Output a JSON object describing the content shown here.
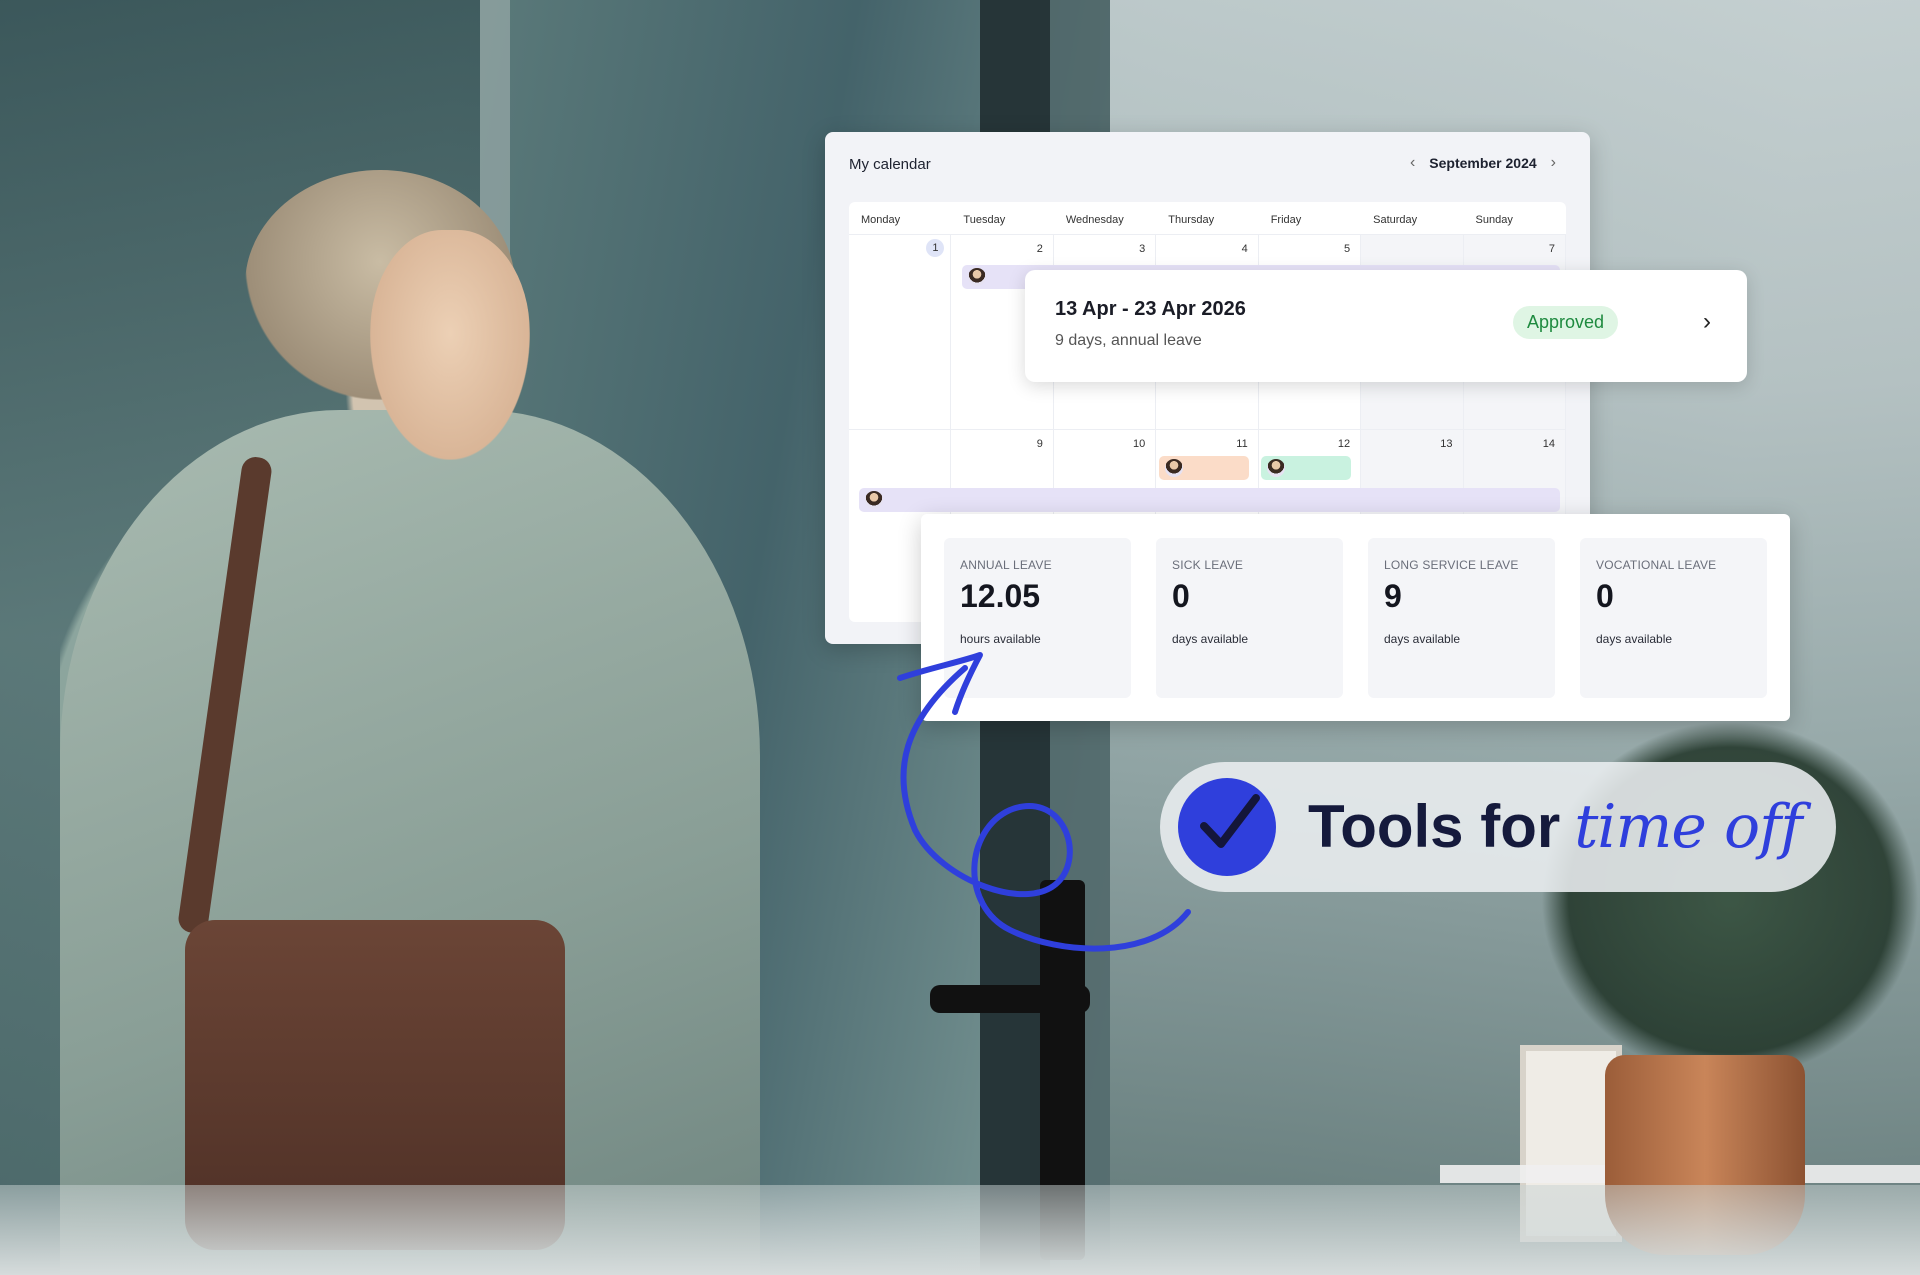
{
  "calendar": {
    "title": "My calendar",
    "month": "September 2024",
    "prev_icon": "chevron-left-icon",
    "next_icon": "chevron-right-icon",
    "weekdays": [
      "Monday",
      "Tuesday",
      "Wednesday",
      "Thursday",
      "Friday",
      "Saturday",
      "Sunday"
    ],
    "week1": [
      "1",
      "2",
      "3",
      "4",
      "5",
      "",
      "7"
    ],
    "week2": [
      "9",
      "10",
      "11",
      "12",
      "13",
      "14"
    ]
  },
  "request": {
    "dates": "13 Apr - 23 Apr 2026",
    "summary": "9 days, annual leave",
    "status": "Approved",
    "status_color": "#1e8a3f"
  },
  "balances": [
    {
      "label": "ANNUAL LEAVE",
      "value": "12.05",
      "unit": "hours available"
    },
    {
      "label": "SICK LEAVE",
      "value": "0",
      "unit": "days available"
    },
    {
      "label": "LONG SERVICE LEAVE",
      "value": "9",
      "unit": "days available"
    },
    {
      "label": "VOCATIONAL LEAVE",
      "value": "0",
      "unit": "days available"
    }
  ],
  "tagline": {
    "main": "Tools for",
    "script": "time off",
    "accent": "#2f3fdc"
  }
}
